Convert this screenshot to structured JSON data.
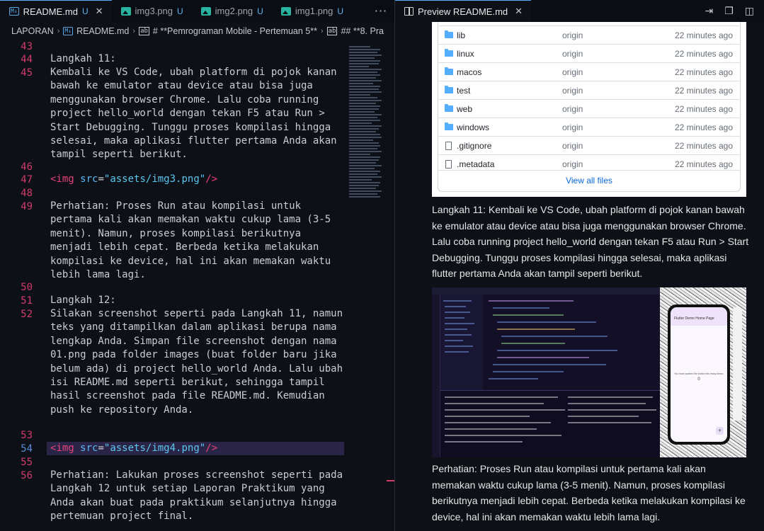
{
  "tabs_left": [
    {
      "label": "README.md",
      "modified": "U",
      "icon": "markdown-icon",
      "active": true
    },
    {
      "label": "img3.png",
      "modified": "U",
      "icon": "image-icon",
      "active": false
    },
    {
      "label": "img2.png",
      "modified": "U",
      "icon": "image-icon",
      "active": false
    },
    {
      "label": "img1.png",
      "modified": "U",
      "icon": "image-icon",
      "active": false
    }
  ],
  "more_label": "···",
  "preview_tab": {
    "label": "Preview README.md",
    "close": "✕"
  },
  "breadcrumb": [
    "LAPORAN",
    "README.md",
    "# **Pemrograman Mobile - Pertemuan 5**",
    "## **8. Pra"
  ],
  "editor": {
    "line_numbers": [
      "43",
      "44",
      "45",
      "46",
      "47",
      "48",
      "49",
      "50",
      "51",
      "52",
      "53",
      "54",
      "55",
      "56"
    ],
    "current_line": "54",
    "langkah11_label": "Langkah 11:",
    "langkah11_text": "Kembali ke VS Code, ubah platform di pojok kanan bawah ke emulator atau device atau bisa juga menggunakan browser Chrome. Lalu coba running project hello_world dengan tekan F5 atau Run > Start Debugging. Tunggu proses kompilasi hingga selesai, maka aplikasi flutter pertama Anda akan tampil seperti berikut.",
    "img3_tag": {
      "open": "<img",
      "attr": "src",
      "eq": "=",
      "value": "\"assets/img3.png\"",
      "close": "/>"
    },
    "perhatian1": "Perhatian: Proses Run atau kompilasi untuk pertama kali akan memakan waktu cukup lama (3-5 menit). Namun, proses kompilasi berikutnya menjadi lebih cepat. Berbeda ketika melakukan kompilasi ke device, hal ini akan memakan waktu lebih lama lagi.",
    "langkah12_label": "Langkah 12:",
    "langkah12_text": "Silakan screenshot seperti pada Langkah 11, namun teks yang ditampilkan dalam aplikasi berupa nama lengkap Anda. Simpan file screenshot dengan nama 01.png pada folder images (buat folder baru jika belum ada) di project hello_world Anda. Lalu ubah isi README.md seperti berikut, sehingga tampil hasil screenshot pada file README.md. Kemudian push ke repository Anda.",
    "img4_tag": {
      "open": "<img",
      "attr": "src",
      "eq": "=",
      "value": "\"assets/img4.png\"",
      "close": "/>"
    },
    "perhatian2": "Perhatian: Lakukan proses screenshot seperti pada Langkah 12 untuk setiap Laporan Praktikum yang Anda akan buat pada praktikum selanjutnya hingga pertemuan project final."
  },
  "preview": {
    "files": [
      {
        "name": "lib",
        "type": "folder",
        "commit": "origin",
        "age": "22 minutes ago"
      },
      {
        "name": "linux",
        "type": "folder",
        "commit": "origin",
        "age": "22 minutes ago"
      },
      {
        "name": "macos",
        "type": "folder",
        "commit": "origin",
        "age": "22 minutes ago"
      },
      {
        "name": "test",
        "type": "folder",
        "commit": "origin",
        "age": "22 minutes ago"
      },
      {
        "name": "web",
        "type": "folder",
        "commit": "origin",
        "age": "22 minutes ago"
      },
      {
        "name": "windows",
        "type": "folder",
        "commit": "origin",
        "age": "22 minutes ago"
      },
      {
        "name": ".gitignore",
        "type": "file",
        "commit": "origin",
        "age": "22 minutes ago"
      },
      {
        "name": ".metadata",
        "type": "file",
        "commit": "origin",
        "age": "22 minutes ago"
      }
    ],
    "view_all": "View all files",
    "paragraph1": "Langkah 11: Kembali ke VS Code, ubah platform di pojok kanan bawah ke emulator atau device atau bisa juga menggunakan browser Chrome. Lalu coba running project hello_world dengan tekan F5 atau Run > Start Debugging. Tunggu proses kompilasi hingga selesai, maka aplikasi flutter pertama Anda akan tampil seperti berikut.",
    "paragraph2": "Perhatian: Proses Run atau kompilasi untuk pertama kali akan memakan waktu cukup lama (3-5 menit). Namun, proses kompilasi berikutnya menjadi lebih cepat. Berbeda ketika melakukan kompilasi ke device, hal ini akan memakan waktu lebih lama lagi.",
    "phone_title": "Flutter Demo Home Page",
    "phone_text": "You have pushed the button this many times:",
    "phone_count": "0",
    "phone_fab": "+"
  },
  "colors": {
    "accent": "#5da8ff",
    "line_number": "#d13c6a",
    "tag": "#e7427a",
    "string": "#5bc7f0"
  }
}
